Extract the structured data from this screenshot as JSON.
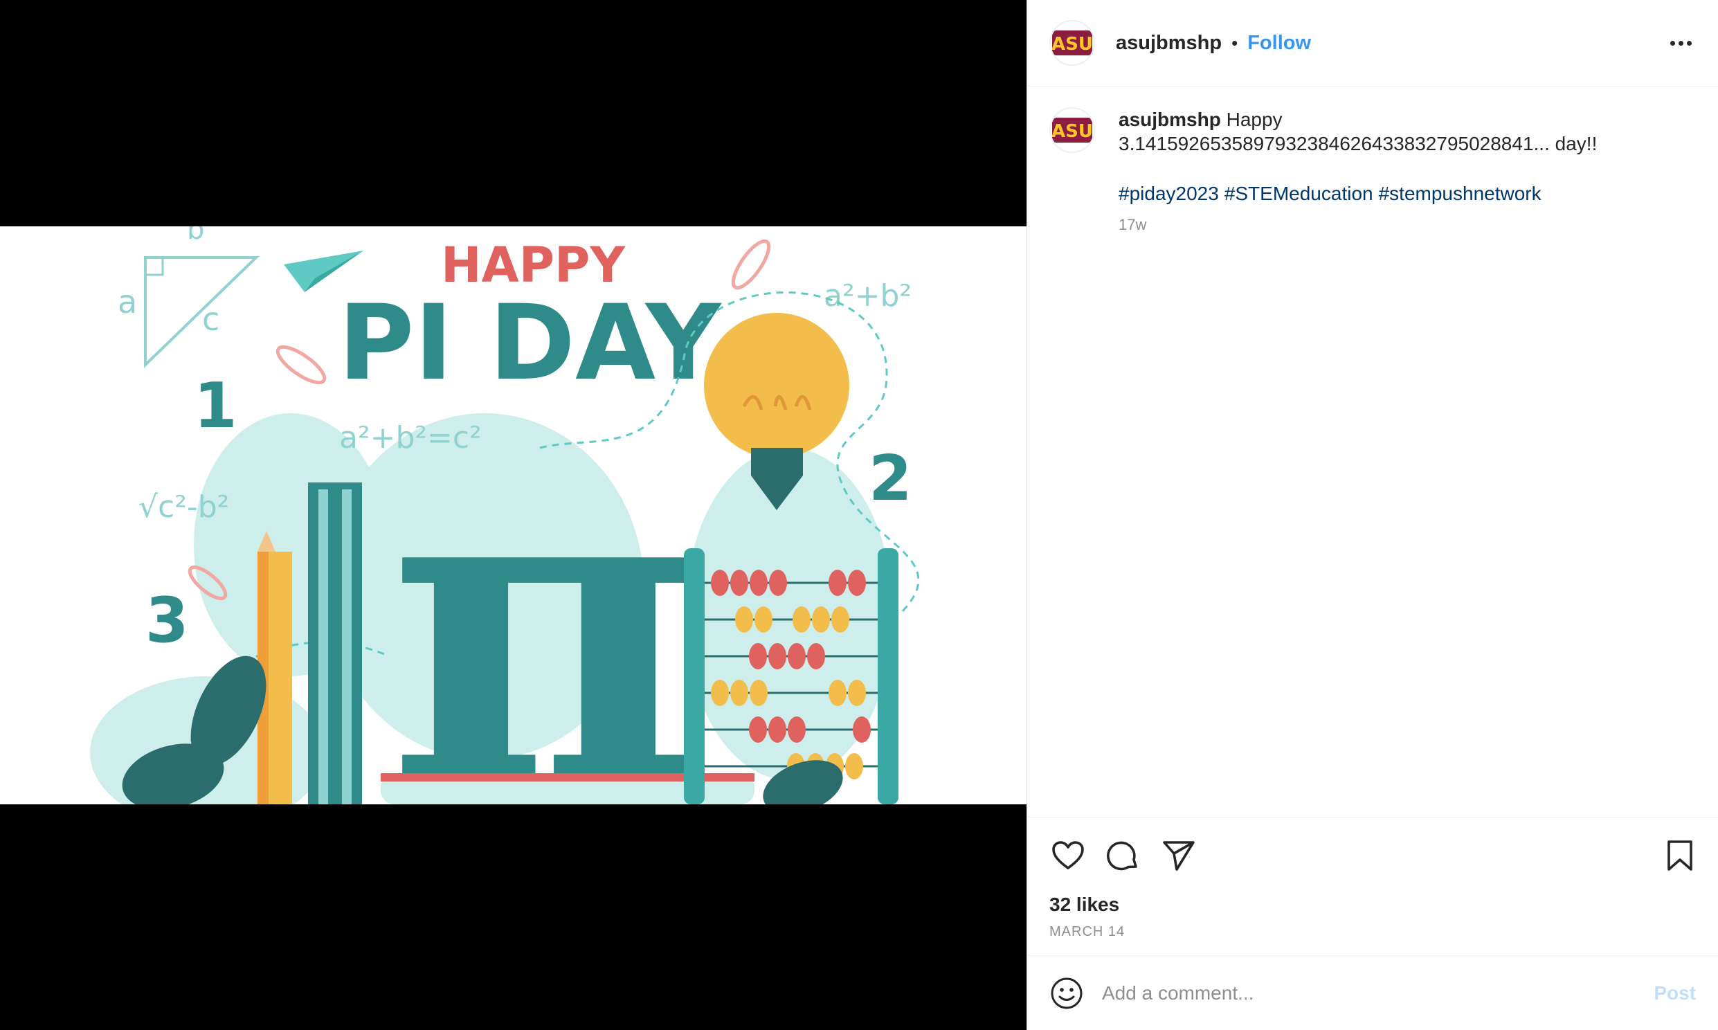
{
  "post": {
    "username": "asujbmshp",
    "follow_label": "Follow",
    "separator": "•",
    "avatar_icon": "asu-logo-icon",
    "image": {
      "headline_small": "HAPPY",
      "headline_large": "PI DAY",
      "pi_symbol": "π",
      "numbers": [
        "1",
        "2",
        "3"
      ],
      "formulas": [
        "a²+b²",
        "a²+b²=c²",
        "√c²-b²"
      ],
      "triangle_labels": [
        "a",
        "b",
        "c"
      ]
    },
    "caption": {
      "username": "asujbmshp",
      "text_line1": "Happy",
      "text_line2": "3.14159265358979323846264338327950288​41... day!!",
      "hashtags": [
        "#piday2023",
        "#STEMeducation",
        "#stempushnetwork"
      ],
      "time_ago": "17w"
    },
    "likes_text": "32 likes",
    "date_text": "MARCH 14",
    "comment": {
      "placeholder": "Add a comment...",
      "post_label": "Post"
    }
  },
  "colors": {
    "accent": "#3797f0",
    "hashtag": "#00376b",
    "teal": "#2e8b8a",
    "light_teal": "#c8ecea",
    "coral": "#e0625f",
    "yellow": "#f3bd4c"
  }
}
